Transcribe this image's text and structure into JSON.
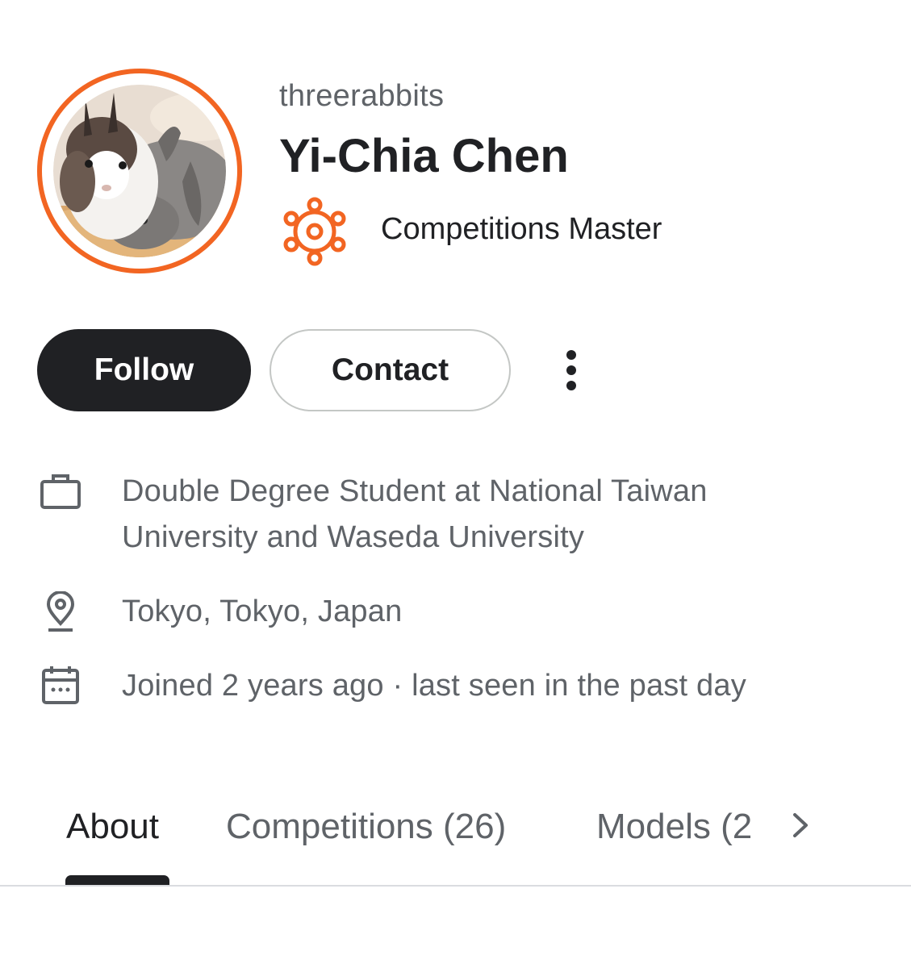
{
  "profile": {
    "username": "threerabbits",
    "display_name": "Yi-Chia Chen",
    "tier_label": "Competitions Master",
    "accent_color": "#f26522",
    "avatar_icon": "rabbits-photo"
  },
  "actions": {
    "follow_label": "Follow",
    "contact_label": "Contact",
    "more_icon": "more-vertical-icon"
  },
  "info": {
    "occupation_line1": "Double Degree Student at National Taiwan",
    "occupation_line2": "University and Waseda University",
    "location": "Tokyo, Tokyo, Japan",
    "joined": "Joined 2 years ago · last seen in the past day"
  },
  "tabs": {
    "about": "About",
    "competitions": "Competitions (26)",
    "models": "Models (2",
    "active": "About"
  }
}
